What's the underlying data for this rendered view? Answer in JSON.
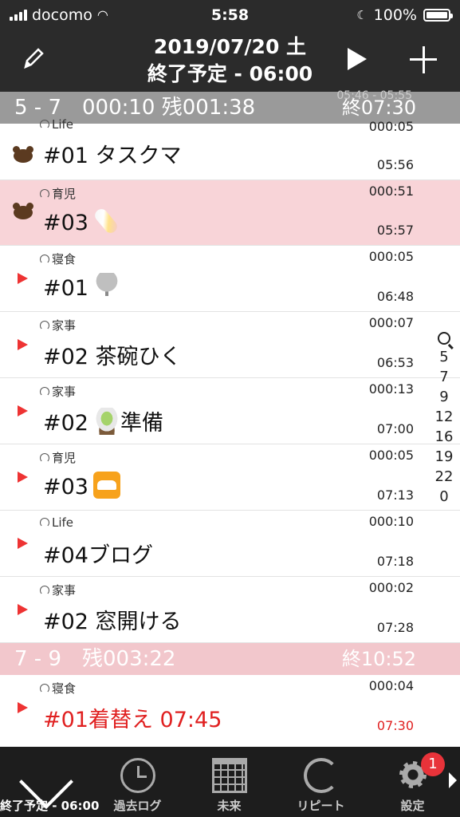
{
  "status_bar": {
    "carrier": "docomo",
    "time": "5:58",
    "battery": "100%"
  },
  "header": {
    "date": "2019/07/20 土",
    "subtitle": "終了予定 - 06:00"
  },
  "sections": [
    {
      "label": "5 - 7　000:10 残001:38",
      "end": "終07:30"
    },
    {
      "label": "7 - 9　残003:22",
      "end": "終10:52"
    }
  ],
  "ghost_text": "05:46 - 05:55",
  "rows": [
    {
      "category": "Life",
      "duration": "000:05",
      "name": "#01 タスクマ",
      "time": "05:56",
      "marker": "bear-icon"
    },
    {
      "category": "育児",
      "duration": "000:51",
      "name": "#03",
      "emoji": "baby-bottle-icon",
      "time": "05:57",
      "marker": "bear-icon"
    },
    {
      "category": "寝食",
      "duration": "000:05",
      "name": "#01",
      "emoji": "microphone-icon",
      "time": "06:48",
      "marker": "play-icon"
    },
    {
      "category": "家事",
      "duration": "000:07",
      "name": "#02 茶碗ひく",
      "time": "06:53",
      "marker": "play-icon"
    },
    {
      "category": "家事",
      "duration": "000:13",
      "name": "#02",
      "emoji": "tea-icon",
      "name_suffix": "準備",
      "time": "07:00",
      "marker": "play-icon"
    },
    {
      "category": "育児",
      "duration": "000:05",
      "name": "#03",
      "emoji": "bed-icon",
      "time": "07:13",
      "marker": "play-icon"
    },
    {
      "category": "Life",
      "duration": "000:10",
      "name": "#04ブログ",
      "time": "07:18",
      "marker": "play-icon"
    },
    {
      "category": "家事",
      "duration": "000:02",
      "name": "#02 窓開ける",
      "time": "07:28",
      "marker": "play-icon"
    },
    {
      "category": "寝食",
      "duration": "000:04",
      "name": "#01着替え 07:45",
      "time": "07:30",
      "marker": "play-icon"
    }
  ],
  "index": [
    "5",
    "7",
    "9",
    "12",
    "16",
    "19",
    "22",
    "0"
  ],
  "tabs": [
    {
      "label": "終了予定 - 06:00",
      "icon": "check-icon"
    },
    {
      "label": "過去ログ",
      "icon": "clock-icon"
    },
    {
      "label": "未来",
      "icon": "calendar-icon"
    },
    {
      "label": "リピート",
      "icon": "repeat-icon"
    },
    {
      "label": "設定",
      "icon": "gear-icon"
    }
  ],
  "badge": "1",
  "colors": {
    "header_bg": "#2b2b2b",
    "section1_bg": "#9a9a9a",
    "section2_bg": "#f2c7cc",
    "highlight_row": "#f8d4d8",
    "accent_red": "#e02020",
    "badge_red": "#e8333a"
  }
}
